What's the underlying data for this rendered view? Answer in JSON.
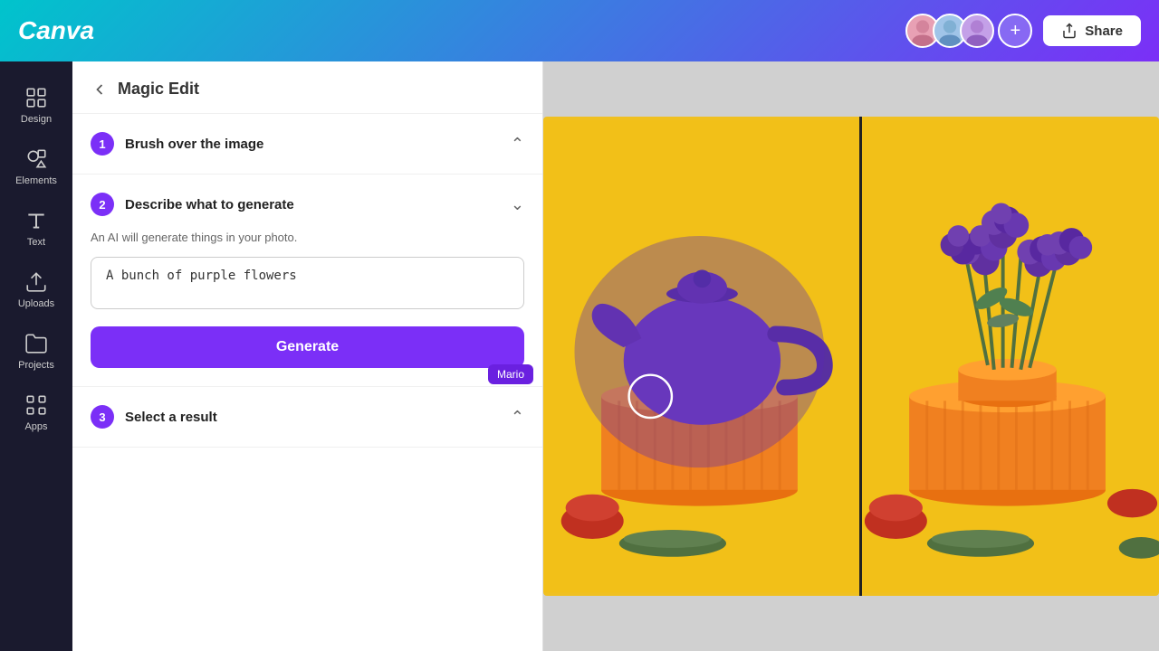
{
  "header": {
    "logo": "Canva",
    "add_collaborator_label": "+",
    "share_label": "Share"
  },
  "sidebar": {
    "items": [
      {
        "id": "design",
        "label": "Design",
        "icon": "grid-icon"
      },
      {
        "id": "elements",
        "label": "Elements",
        "icon": "shapes-icon"
      },
      {
        "id": "text",
        "label": "Text",
        "icon": "text-icon"
      },
      {
        "id": "uploads",
        "label": "Uploads",
        "icon": "upload-icon"
      },
      {
        "id": "projects",
        "label": "Projects",
        "icon": "folder-icon"
      },
      {
        "id": "apps",
        "label": "Apps",
        "icon": "apps-icon"
      }
    ]
  },
  "panel": {
    "back_label": "←",
    "title": "Magic Edit",
    "step1": {
      "number": "1",
      "title": "Brush over the image",
      "collapsed": false
    },
    "step2": {
      "number": "2",
      "title": "Describe what to generate",
      "description": "An AI will generate things in your photo.",
      "placeholder": "A bunch of purple flowers",
      "input_value": "A bunch of purple flowers",
      "generate_label": "Generate",
      "tooltip": "Mario"
    },
    "step3": {
      "number": "3",
      "title": "Select a result",
      "collapsed": true
    }
  },
  "colors": {
    "brand_purple": "#7b2ff7",
    "header_gradient_start": "#00c4cc",
    "header_gradient_end": "#7b2ff7",
    "sidebar_bg": "#1a1a2e",
    "canvas_bg": "#cccccc",
    "image_bg": "#f0c020"
  }
}
